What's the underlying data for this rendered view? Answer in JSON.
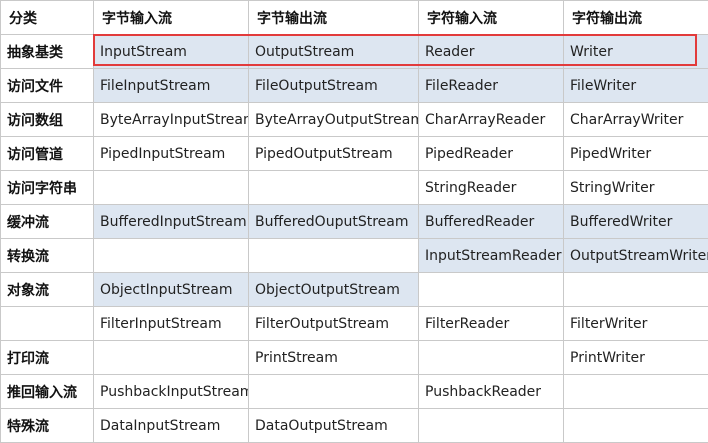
{
  "columns": [
    "分类",
    "字节输入流",
    "字节输出流",
    "字符输入流",
    "字符输出流"
  ],
  "rows": [
    {
      "category": "抽象基类",
      "byte_in": "InputStream",
      "byte_out": "OutputStream",
      "char_in": "Reader",
      "char_out": "Writer"
    },
    {
      "category": "访问文件",
      "byte_in": "FileInputStream",
      "byte_out": "FileOutputStream",
      "char_in": "FileReader",
      "char_out": "FileWriter"
    },
    {
      "category": "访问数组",
      "byte_in": "ByteArrayInputStream",
      "byte_out": "ByteArrayOutputStream",
      "char_in": "CharArrayReader",
      "char_out": "CharArrayWriter"
    },
    {
      "category": "访问管道",
      "byte_in": "PipedInputStream",
      "byte_out": "PipedOutputStream",
      "char_in": "PipedReader",
      "char_out": "PipedWriter"
    },
    {
      "category": "访问字符串",
      "byte_in": "",
      "byte_out": "",
      "char_in": "StringReader",
      "char_out": "StringWriter"
    },
    {
      "category": "缓冲流",
      "byte_in": "BufferedInputStream",
      "byte_out": "BufferedOuputStream",
      "char_in": "BufferedReader",
      "char_out": "BufferedWriter"
    },
    {
      "category": "转换流",
      "byte_in": "",
      "byte_out": "",
      "char_in": "InputStreamReader",
      "char_out": "OutputStreamWriter"
    },
    {
      "category": "对象流",
      "byte_in": "ObjectInputStream",
      "byte_out": "ObjectOutputStream",
      "char_in": "",
      "char_out": ""
    },
    {
      "category": "",
      "byte_in": "FilterInputStream",
      "byte_out": "FilterOutputStream",
      "char_in": "FilterReader",
      "char_out": "FilterWriter"
    },
    {
      "category": "打印流",
      "byte_in": "",
      "byte_out": "PrintStream",
      "char_in": "",
      "char_out": "PrintWriter"
    },
    {
      "category": "推回输入流",
      "byte_in": "PushbackInputStream",
      "byte_out": "",
      "char_in": "PushbackReader",
      "char_out": ""
    },
    {
      "category": "特殊流",
      "byte_in": "DataInputStream",
      "byte_out": "DataOutputStream",
      "char_in": "",
      "char_out": ""
    }
  ],
  "highlight_color": "#dde6f1",
  "highlight_box_color": "#e23b3b"
}
